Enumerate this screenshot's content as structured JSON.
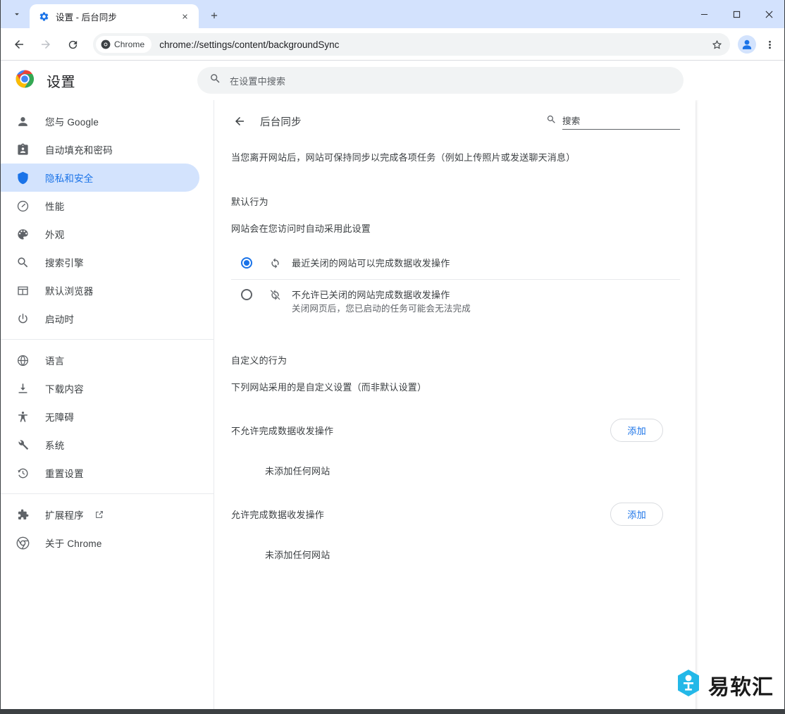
{
  "window": {
    "minimize_label": "minimize",
    "maximize_label": "maximize",
    "close_label": "close"
  },
  "tabstrip": {
    "tab_search_icon": "chevron-down-icon",
    "new_tab_icon": "plus-icon",
    "tabs": [
      {
        "title": "设置 - 后台同步",
        "favicon": "gear-icon",
        "close_icon": "close-icon"
      }
    ]
  },
  "toolbar": {
    "back_icon": "arrow-back-icon",
    "forward_icon": "arrow-forward-icon",
    "reload_icon": "reload-icon",
    "chip_label": "Chrome",
    "chip_icon": "chrome-icon",
    "url": "chrome://settings/content/backgroundSync",
    "bookmark_icon": "star-icon",
    "profile_icon": "avatar-icon",
    "menu_icon": "three-dots-icon"
  },
  "settings_header": {
    "logo": "chrome-logo-icon",
    "title": "设置",
    "search_icon": "search-icon",
    "search_placeholder": "在设置中搜索"
  },
  "sidebar": {
    "groups": [
      {
        "items": [
          {
            "label": "您与 Google",
            "icon": "person-icon",
            "selected": false
          },
          {
            "label": "自动填充和密码",
            "icon": "clipboard-icon",
            "selected": false
          },
          {
            "label": "隐私和安全",
            "icon": "shield-icon",
            "selected": true
          },
          {
            "label": "性能",
            "icon": "speedometer-icon",
            "selected": false
          },
          {
            "label": "外观",
            "icon": "palette-icon",
            "selected": false
          },
          {
            "label": "搜索引擎",
            "icon": "search-icon",
            "selected": false
          },
          {
            "label": "默认浏览器",
            "icon": "browser-window-icon",
            "selected": false
          },
          {
            "label": "启动时",
            "icon": "power-icon",
            "selected": false
          }
        ]
      },
      {
        "items": [
          {
            "label": "语言",
            "icon": "globe-icon",
            "selected": false
          },
          {
            "label": "下载内容",
            "icon": "download-icon",
            "selected": false
          },
          {
            "label": "无障碍",
            "icon": "accessibility-icon",
            "selected": false
          },
          {
            "label": "系统",
            "icon": "wrench-icon",
            "selected": false
          },
          {
            "label": "重置设置",
            "icon": "history-restore-icon",
            "selected": false
          }
        ]
      },
      {
        "items": [
          {
            "label": "扩展程序",
            "icon": "puzzle-icon",
            "selected": false,
            "external_icon": "open-in-new-icon"
          },
          {
            "label": "关于 Chrome",
            "icon": "chrome-icon",
            "selected": false
          }
        ]
      }
    ]
  },
  "content": {
    "back_icon": "arrow-back-icon",
    "page_title": "后台同步",
    "search_icon": "search-icon",
    "search_placeholder": "搜索",
    "description": "当您离开网站后，网站可保持同步以完成各项任务（例如上传照片或发送聊天消息）",
    "default_behavior_title": "默认行为",
    "default_behavior_sub": "网站会在您访问时自动采用此设置",
    "radio_options": [
      {
        "label": "最近关闭的网站可以完成数据收发操作",
        "sub": "",
        "icon": "sync-icon",
        "checked": true
      },
      {
        "label": "不允许已关闭的网站完成数据收发操作",
        "sub": "关闭网页后，您已启动的任务可能会无法完成",
        "icon": "sync-disabled-icon",
        "checked": false
      }
    ],
    "custom_behavior_title": "自定义的行为",
    "custom_behavior_sub": "下列网站采用的是自定义设置（而非默认设置）",
    "permission_blocks": [
      {
        "title": "不允许完成数据收发操作",
        "add_label": "添加",
        "empty_note": "未添加任何网站"
      },
      {
        "title": "允许完成数据收发操作",
        "add_label": "添加",
        "empty_note": "未添加任何网站"
      }
    ]
  },
  "watermark": {
    "text": "易软汇",
    "logo_color": "#23b8e8"
  },
  "colors": {
    "accent": "#1a73e8",
    "selected_nav_bg": "#d3e3fd",
    "tabstrip_bg": "#d3e2fd",
    "text_primary": "#3c4043",
    "text_secondary": "#5f6368"
  }
}
